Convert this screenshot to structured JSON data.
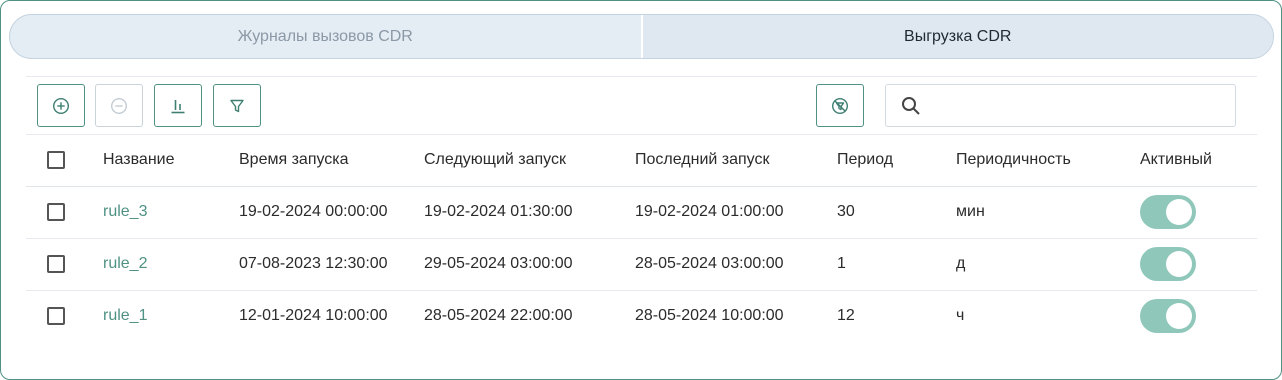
{
  "tabs": [
    {
      "label": "Журналы вызовов CDR",
      "active": false
    },
    {
      "label": "Выгрузка CDR",
      "active": true
    }
  ],
  "toolbar": {
    "add_icon": "plus-circle-icon",
    "remove_icon": "minus-circle-icon",
    "columns_icon": "bar-columns-icon",
    "filter_icon": "filter-icon",
    "clear_filter_icon": "filter-off-icon",
    "search": {
      "value": "",
      "placeholder": "",
      "icon": "search-icon"
    }
  },
  "table": {
    "headers": {
      "name": "Название",
      "start": "Время запуска",
      "next": "Следующий запуск",
      "last": "Последний запуск",
      "period": "Период",
      "freq": "Периодичность",
      "active": "Активный"
    },
    "rows": [
      {
        "name": "rule_3",
        "start": "19-02-2024 00:00:00",
        "next": "19-02-2024 01:30:00",
        "last": "19-02-2024 01:00:00",
        "period": "30",
        "freq": "мин",
        "active": true
      },
      {
        "name": "rule_2",
        "start": "07-08-2023 12:30:00",
        "next": "29-05-2024 03:00:00",
        "last": "28-05-2024 03:00:00",
        "period": "1",
        "freq": "д",
        "active": true
      },
      {
        "name": "rule_1",
        "start": "12-01-2024 10:00:00",
        "next": "28-05-2024 22:00:00",
        "last": "28-05-2024 10:00:00",
        "period": "12",
        "freq": "ч",
        "active": true
      }
    ]
  },
  "colors": {
    "accent": "#4f9183",
    "toggle_on": "#8fc7bb",
    "tab_bg": "#e4ecf4"
  }
}
